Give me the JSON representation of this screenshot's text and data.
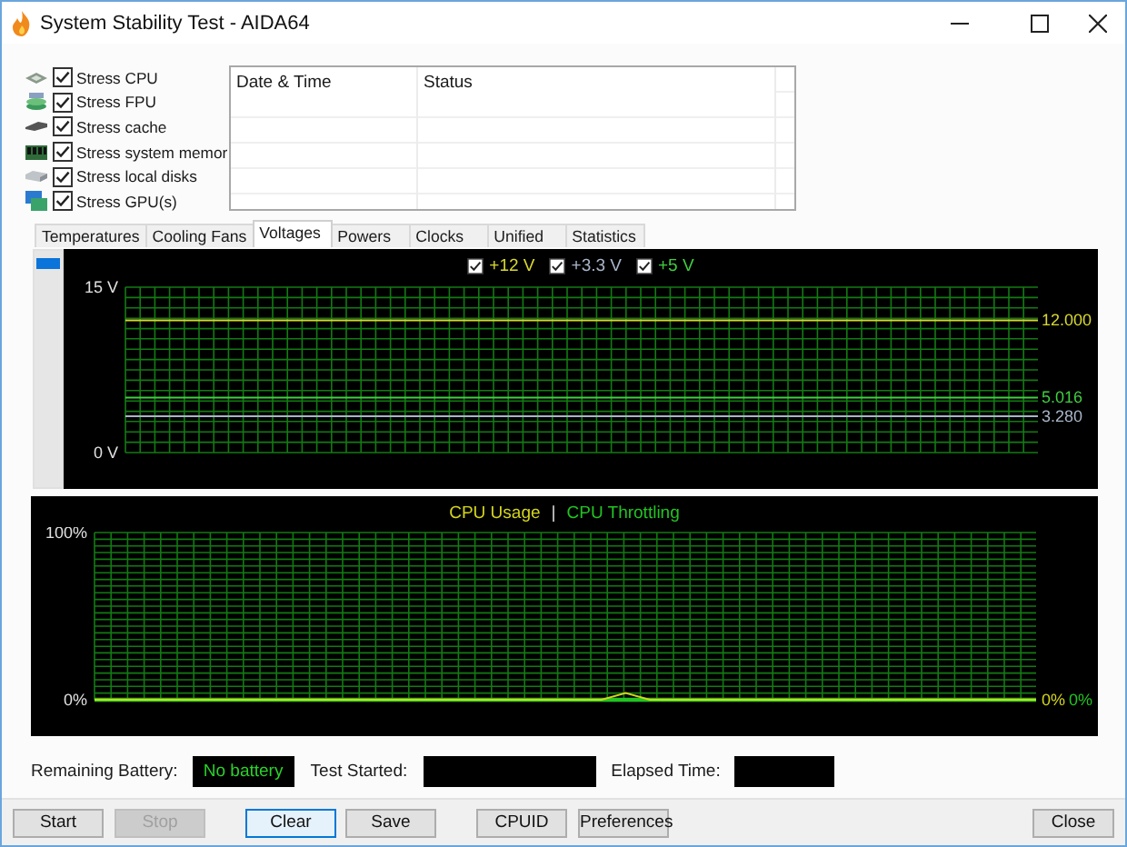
{
  "window": {
    "title": "System Stability Test - AIDA64"
  },
  "stress_options": [
    {
      "label": "Stress CPU",
      "checked": true
    },
    {
      "label": "Stress FPU",
      "checked": true
    },
    {
      "label": "Stress cache",
      "checked": true
    },
    {
      "label": "Stress system memor",
      "checked": true
    },
    {
      "label": "Stress local disks",
      "checked": true
    },
    {
      "label": "Stress GPU(s)",
      "checked": true
    }
  ],
  "log_table": {
    "columns": [
      "Date & Time",
      "Status"
    ]
  },
  "tabs": [
    {
      "label": "Temperatures",
      "selected": false
    },
    {
      "label": "Cooling Fans",
      "selected": false
    },
    {
      "label": "Voltages",
      "selected": true
    },
    {
      "label": "Powers",
      "selected": false
    },
    {
      "label": "Clocks",
      "selected": false
    },
    {
      "label": "Unified",
      "selected": false
    },
    {
      "label": "Statistics",
      "selected": false
    }
  ],
  "voltage_panel": {
    "legend": [
      {
        "checked": true
      },
      {
        "checked": true
      },
      {
        "checked": true
      }
    ],
    "readings": [
      "12.000",
      "5.016",
      "3.280"
    ],
    "chart_data": {
      "type": "line",
      "grid": true,
      "ylim": [
        0,
        15
      ],
      "yticks": [
        {
          "value": 15,
          "label": "15 V"
        },
        {
          "value": 0,
          "label": "0 V"
        }
      ],
      "series": [
        {
          "name": "+12 V",
          "color": "#d8d830",
          "values": [
            12,
            12,
            12,
            12,
            12,
            12,
            12,
            12,
            12,
            12
          ]
        },
        {
          "name": "+3.3 V",
          "color": "#a9b5c9",
          "values": [
            3.3,
            3.3,
            3.3,
            3.3,
            3.3,
            3.3,
            3.3,
            3.3,
            3.3,
            3.3
          ]
        },
        {
          "name": "+5 V",
          "color": "#3fcf3f",
          "values": [
            5,
            5,
            5,
            5,
            5,
            5,
            5,
            5,
            5,
            5
          ]
        }
      ]
    }
  },
  "cpu_panel": {
    "separator": "|",
    "readings": [
      "0%",
      "0%"
    ],
    "chart_data": {
      "type": "line",
      "grid": true,
      "ylim": [
        0,
        100
      ],
      "yticks": [
        {
          "value": 100,
          "label": "100%"
        },
        {
          "value": 0,
          "label": "0%"
        }
      ],
      "series": [
        {
          "name": "CPU Usage",
          "color": "#d4d41e",
          "values": [
            0,
            0,
            0,
            0,
            0,
            0,
            0,
            0,
            0,
            0,
            0,
            0,
            0,
            0,
            0,
            0,
            0,
            0,
            0,
            0,
            0,
            0,
            4,
            0,
            0,
            0,
            0,
            0,
            0,
            0,
            0,
            0,
            0,
            0,
            0,
            0,
            0,
            0,
            0,
            0
          ]
        },
        {
          "name": "CPU Throttling",
          "color": "#22c322",
          "values": [
            0,
            0,
            0,
            0,
            0,
            0,
            0,
            0,
            0,
            0,
            0,
            0,
            0,
            0,
            0,
            0,
            0,
            0,
            0,
            0,
            0,
            0,
            0,
            0,
            0,
            0,
            0,
            0,
            0,
            0,
            0,
            0,
            0,
            0,
            0,
            0,
            0,
            0,
            0,
            0
          ]
        }
      ]
    }
  },
  "status": {
    "battery_label": "Remaining Battery:",
    "battery_value": "No battery",
    "started_label": "Test Started:",
    "elapsed_label": "Elapsed Time:"
  },
  "buttons": [
    {
      "label": "Start",
      "disabled": false,
      "focused": false
    },
    {
      "label": "Stop",
      "disabled": true,
      "focused": false
    },
    {
      "label": "Clear",
      "disabled": false,
      "focused": true
    },
    {
      "label": "Save",
      "disabled": false,
      "focused": false
    },
    {
      "label": "CPUID",
      "disabled": false,
      "focused": false
    },
    {
      "label": "Preferences",
      "disabled": false,
      "focused": false
    },
    {
      "label": "Close",
      "disabled": false,
      "focused": false
    }
  ]
}
